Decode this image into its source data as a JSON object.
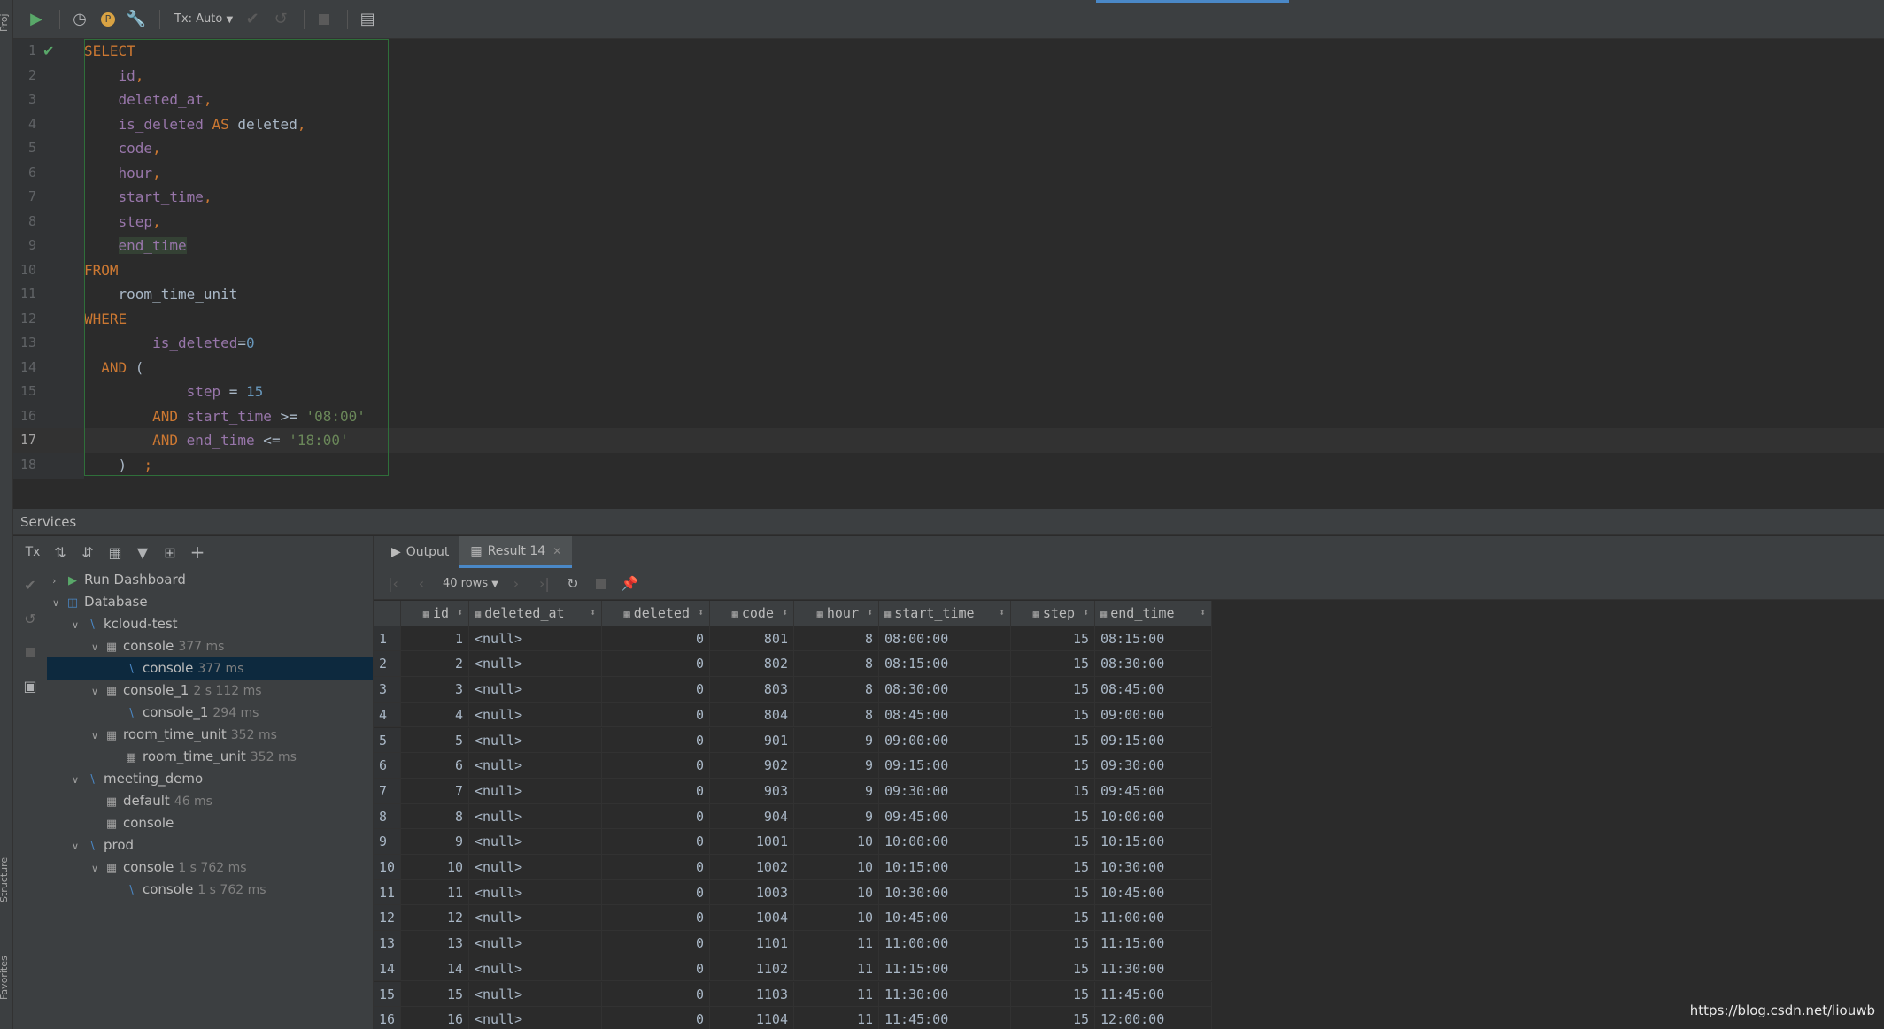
{
  "toolbar": {
    "tx_label": "Tx: Auto"
  },
  "sidebar_labels": {
    "project": "Proj",
    "structure": "Structure",
    "favorites": "Favorites"
  },
  "editor": {
    "lines": [
      {
        "n": "1",
        "tokens": [
          {
            "t": "SELECT",
            "c": "kw"
          }
        ]
      },
      {
        "n": "2",
        "tokens": [
          {
            "t": "    ",
            "c": "ident"
          },
          {
            "t": "id",
            "c": "col"
          },
          {
            "t": ",",
            "c": "kw"
          }
        ]
      },
      {
        "n": "3",
        "tokens": [
          {
            "t": "    ",
            "c": "ident"
          },
          {
            "t": "deleted_at",
            "c": "col"
          },
          {
            "t": ",",
            "c": "kw"
          }
        ]
      },
      {
        "n": "4",
        "tokens": [
          {
            "t": "    ",
            "c": "ident"
          },
          {
            "t": "is_deleted",
            "c": "col"
          },
          {
            "t": " AS ",
            "c": "kw"
          },
          {
            "t": "deleted",
            "c": "ident"
          },
          {
            "t": ",",
            "c": "kw"
          }
        ]
      },
      {
        "n": "5",
        "tokens": [
          {
            "t": "    ",
            "c": "ident"
          },
          {
            "t": "code",
            "c": "col"
          },
          {
            "t": ",",
            "c": "kw"
          }
        ]
      },
      {
        "n": "6",
        "tokens": [
          {
            "t": "    ",
            "c": "ident"
          },
          {
            "t": "hour",
            "c": "col"
          },
          {
            "t": ",",
            "c": "kw"
          }
        ]
      },
      {
        "n": "7",
        "tokens": [
          {
            "t": "    ",
            "c": "ident"
          },
          {
            "t": "start_time",
            "c": "col"
          },
          {
            "t": ",",
            "c": "kw"
          }
        ]
      },
      {
        "n": "8",
        "tokens": [
          {
            "t": "    ",
            "c": "ident"
          },
          {
            "t": "step",
            "c": "col"
          },
          {
            "t": ",",
            "c": "kw"
          }
        ]
      },
      {
        "n": "9",
        "tokens": [
          {
            "t": "    ",
            "c": "ident"
          },
          {
            "t": "end_time",
            "c": "col hl"
          }
        ]
      },
      {
        "n": "10",
        "tokens": [
          {
            "t": "FROM",
            "c": "kw"
          }
        ]
      },
      {
        "n": "11",
        "tokens": [
          {
            "t": "    room_time_unit",
            "c": "ident"
          }
        ]
      },
      {
        "n": "12",
        "tokens": [
          {
            "t": "WHERE",
            "c": "kw"
          }
        ]
      },
      {
        "n": "13",
        "tokens": [
          {
            "t": "        ",
            "c": "ident"
          },
          {
            "t": "is_deleted",
            "c": "col"
          },
          {
            "t": "=",
            "c": "ident"
          },
          {
            "t": "0",
            "c": "num"
          }
        ]
      },
      {
        "n": "14",
        "tokens": [
          {
            "t": "  ",
            "c": "ident"
          },
          {
            "t": "AND",
            "c": "kw"
          },
          {
            "t": " (",
            "c": "ident"
          }
        ]
      },
      {
        "n": "15",
        "tokens": [
          {
            "t": "            ",
            "c": "ident"
          },
          {
            "t": "step",
            "c": "col"
          },
          {
            "t": " = ",
            "c": "ident"
          },
          {
            "t": "15",
            "c": "num"
          }
        ]
      },
      {
        "n": "16",
        "tokens": [
          {
            "t": "        ",
            "c": "ident"
          },
          {
            "t": "AND",
            "c": "kw"
          },
          {
            "t": " ",
            "c": "ident"
          },
          {
            "t": "start_time",
            "c": "col"
          },
          {
            "t": " >= ",
            "c": "ident"
          },
          {
            "t": "'08:00'",
            "c": "str"
          }
        ]
      },
      {
        "n": "17",
        "tokens": [
          {
            "t": "        ",
            "c": "ident"
          },
          {
            "t": "AND",
            "c": "kw"
          },
          {
            "t": " ",
            "c": "ident"
          },
          {
            "t": "end_time",
            "c": "col"
          },
          {
            "t": " <= ",
            "c": "ident"
          },
          {
            "t": "'18:00'",
            "c": "str"
          }
        ]
      },
      {
        "n": "18",
        "tokens": [
          {
            "t": "    )  ",
            "c": "ident"
          },
          {
            "t": ";",
            "c": "kw"
          }
        ]
      }
    ],
    "current_line": 17
  },
  "services": {
    "title": "Services",
    "tx_label": "Tx",
    "tree": [
      {
        "label": "Run Dashboard",
        "time": "",
        "depth": 0,
        "chev": "",
        "icon": "run"
      },
      {
        "label": "Database",
        "time": "",
        "depth": 0,
        "chev": "open",
        "icon": "db"
      },
      {
        "label": "kcloud-test",
        "time": "",
        "depth": 1,
        "chev": "open",
        "icon": "ds"
      },
      {
        "label": "console",
        "time": "377 ms",
        "depth": 2,
        "chev": "open",
        "icon": "session"
      },
      {
        "label": "console",
        "time": "377 ms",
        "depth": 3,
        "chev": "",
        "icon": "console",
        "selected": true
      },
      {
        "label": "console_1",
        "time": "2 s 112 ms",
        "depth": 2,
        "chev": "open",
        "icon": "session"
      },
      {
        "label": "console_1",
        "time": "294 ms",
        "depth": 3,
        "chev": "",
        "icon": "console"
      },
      {
        "label": "room_time_unit",
        "time": "352 ms",
        "depth": 2,
        "chev": "open",
        "icon": "session"
      },
      {
        "label": "room_time_unit",
        "time": "352 ms",
        "depth": 3,
        "chev": "",
        "icon": "table"
      },
      {
        "label": "meeting_demo",
        "time": "",
        "depth": 1,
        "chev": "open",
        "icon": "ds"
      },
      {
        "label": "default",
        "time": "46 ms",
        "depth": 2,
        "chev": "",
        "icon": "session"
      },
      {
        "label": "console",
        "time": "",
        "depth": 2,
        "chev": "",
        "icon": "session"
      },
      {
        "label": "prod",
        "time": "",
        "depth": 1,
        "chev": "open",
        "icon": "ds"
      },
      {
        "label": "console",
        "time": "1 s 762 ms",
        "depth": 2,
        "chev": "open",
        "icon": "session"
      },
      {
        "label": "console",
        "time": "1 s 762 ms",
        "depth": 3,
        "chev": "",
        "icon": "console"
      }
    ]
  },
  "results": {
    "tabs": [
      {
        "label": "Output",
        "active": false
      },
      {
        "label": "Result 14",
        "active": true
      }
    ],
    "rows_label": "40 rows",
    "columns": [
      "id",
      "deleted_at",
      "deleted",
      "code",
      "hour",
      "start_time",
      "step",
      "end_time"
    ],
    "rows": [
      [
        "1",
        "1",
        "<null>",
        "0",
        "801",
        "8",
        "08:00:00",
        "15",
        "08:15:00"
      ],
      [
        "2",
        "2",
        "<null>",
        "0",
        "802",
        "8",
        "08:15:00",
        "15",
        "08:30:00"
      ],
      [
        "3",
        "3",
        "<null>",
        "0",
        "803",
        "8",
        "08:30:00",
        "15",
        "08:45:00"
      ],
      [
        "4",
        "4",
        "<null>",
        "0",
        "804",
        "8",
        "08:45:00",
        "15",
        "09:00:00"
      ],
      [
        "5",
        "5",
        "<null>",
        "0",
        "901",
        "9",
        "09:00:00",
        "15",
        "09:15:00"
      ],
      [
        "6",
        "6",
        "<null>",
        "0",
        "902",
        "9",
        "09:15:00",
        "15",
        "09:30:00"
      ],
      [
        "7",
        "7",
        "<null>",
        "0",
        "903",
        "9",
        "09:30:00",
        "15",
        "09:45:00"
      ],
      [
        "8",
        "8",
        "<null>",
        "0",
        "904",
        "9",
        "09:45:00",
        "15",
        "10:00:00"
      ],
      [
        "9",
        "9",
        "<null>",
        "0",
        "1001",
        "10",
        "10:00:00",
        "15",
        "10:15:00"
      ],
      [
        "10",
        "10",
        "<null>",
        "0",
        "1002",
        "10",
        "10:15:00",
        "15",
        "10:30:00"
      ],
      [
        "11",
        "11",
        "<null>",
        "0",
        "1003",
        "10",
        "10:30:00",
        "15",
        "10:45:00"
      ],
      [
        "12",
        "12",
        "<null>",
        "0",
        "1004",
        "10",
        "10:45:00",
        "15",
        "11:00:00"
      ],
      [
        "13",
        "13",
        "<null>",
        "0",
        "1101",
        "11",
        "11:00:00",
        "15",
        "11:15:00"
      ],
      [
        "14",
        "14",
        "<null>",
        "0",
        "1102",
        "11",
        "11:15:00",
        "15",
        "11:30:00"
      ],
      [
        "15",
        "15",
        "<null>",
        "0",
        "1103",
        "11",
        "11:30:00",
        "15",
        "11:45:00"
      ],
      [
        "16",
        "16",
        "<null>",
        "0",
        "1104",
        "11",
        "11:45:00",
        "15",
        "12:00:00"
      ]
    ]
  },
  "watermark": "https://blog.csdn.net/liouwb",
  "colors": {
    "accent": "#4a88c7",
    "keyword": "#cc7832",
    "column": "#9876aa",
    "number": "#6897bb",
    "string": "#6a8759",
    "run_green": "#59a869"
  }
}
